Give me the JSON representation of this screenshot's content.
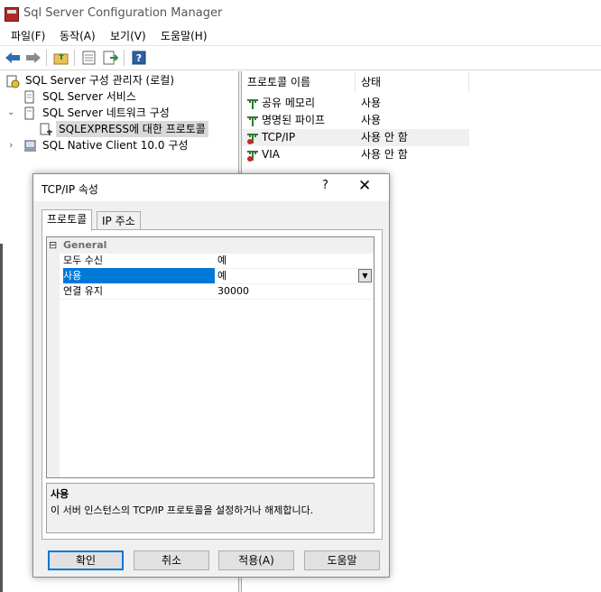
{
  "window": {
    "title": "Sql Server Configuration Manager"
  },
  "menu": [
    "파일(F)",
    "동작(A)",
    "보기(V)",
    "도움말(H)"
  ],
  "tree": {
    "root": "SQL Server 구성 관리자 (로컬)",
    "services": "SQL Server 서비스",
    "network": "SQL Server 네트워크 구성",
    "network_child": "SQLEXPRESS에 대한 프로토콜",
    "native_client": "SQL Native Client 10.0 구성"
  },
  "protocols": {
    "headers": [
      "프로토콜 이름",
      "상태"
    ],
    "rows": [
      {
        "name": "공유 메모리",
        "state": "사용"
      },
      {
        "name": "명명된 파이프",
        "state": "사용"
      },
      {
        "name": "TCP/IP",
        "state": "사용 안 함"
      },
      {
        "name": "VIA",
        "state": "사용 안 함"
      }
    ]
  },
  "dialog": {
    "title": "TCP/IP 속성",
    "help": "?",
    "close": "✕",
    "tabs": [
      "프로토콜",
      "IP 주소"
    ],
    "category": "General",
    "category_toggle": "⊟",
    "properties": [
      {
        "name": "모두 수신",
        "value": "예"
      },
      {
        "name": "사용",
        "value": "예"
      },
      {
        "name": "연결 유지",
        "value": "30000"
      }
    ],
    "description_title": "사용",
    "description_text": "이 서버 인스턴스의 TCP/IP 프로토콜을 설정하거나 해제합니다.",
    "buttons": {
      "ok": "확인",
      "cancel": "취소",
      "apply": "적용(A)",
      "help": "도움말"
    }
  },
  "colors": {
    "selection": "#0078d7",
    "accent_icon": "#2b6fb0"
  }
}
